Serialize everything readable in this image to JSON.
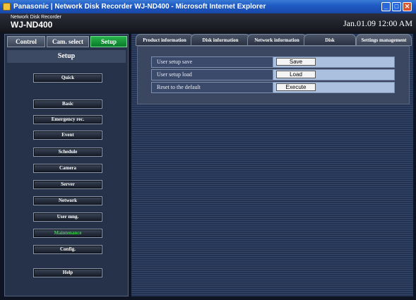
{
  "window": {
    "title": "Panasonic | Network Disk Recorder WJ-ND400 - Microsoft Internet Explorer"
  },
  "header": {
    "subtitle": "Network Disk Recorder",
    "model": "WJ-ND400",
    "datetime": "Jan.01.09  12:00  AM"
  },
  "nav_tabs": [
    "Control",
    "Cam. select",
    "Setup"
  ],
  "setup_panel": {
    "title": "Setup",
    "menu": [
      "Quick",
      "Basic",
      "Emergency rec.",
      "Event",
      "Schedule",
      "Camera",
      "Server",
      "Network",
      "User mng.",
      "Maintenance",
      "Config.",
      "Help"
    ],
    "active_item": "Maintenance"
  },
  "maintenance_tabs": [
    "Product information",
    "Disk information",
    "Network information",
    "Disk",
    "Settings management"
  ],
  "settings": [
    {
      "label": "User setup save",
      "action": "Save"
    },
    {
      "label": "User setup load",
      "action": "Load"
    },
    {
      "label": "Reset to the default",
      "action": "Execute"
    }
  ],
  "colors": {
    "active_green": "#3ad14a",
    "setup_tab": "#1a9a3a",
    "titlebar": "#1f5bc4"
  }
}
